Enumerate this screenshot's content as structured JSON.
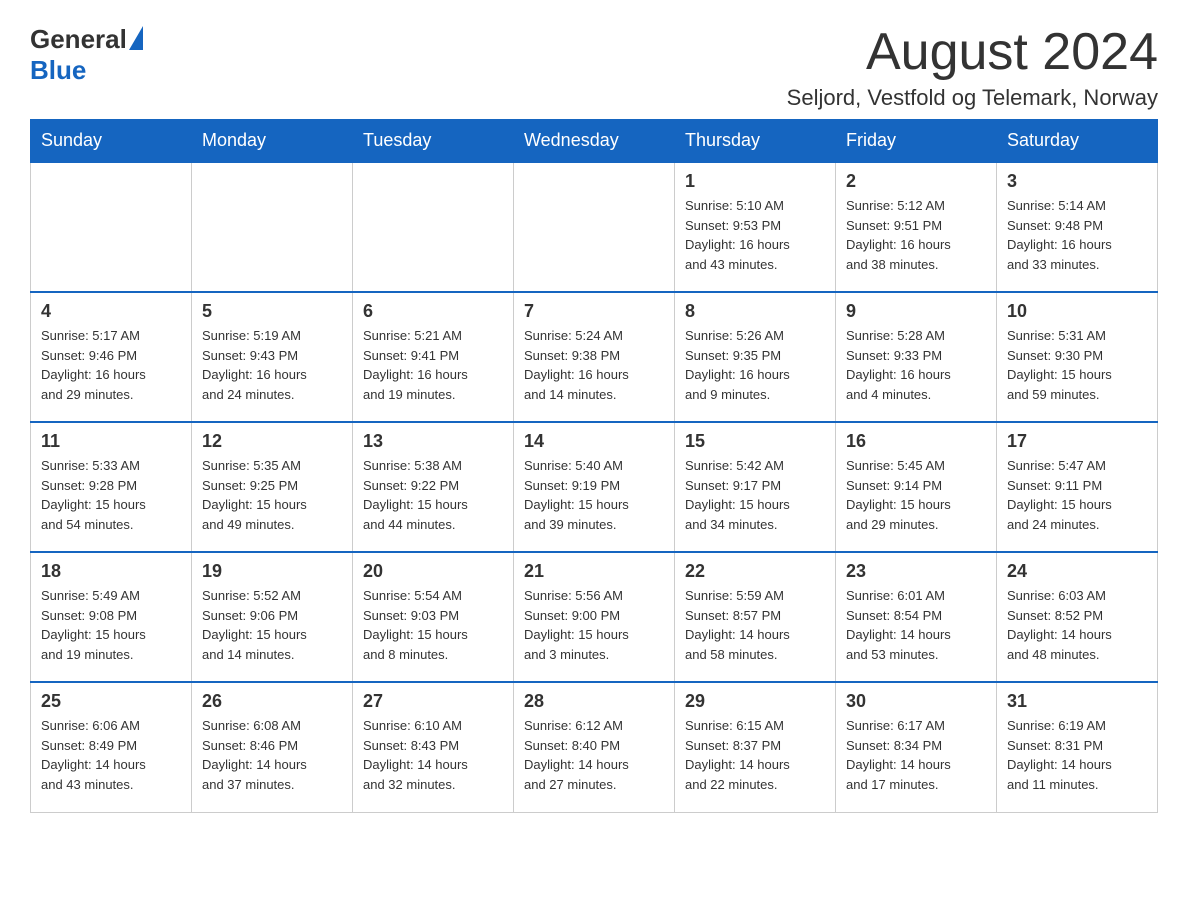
{
  "header": {
    "logo_general": "General",
    "logo_blue": "Blue",
    "month_title": "August 2024",
    "location": "Seljord, Vestfold og Telemark, Norway"
  },
  "weekdays": [
    "Sunday",
    "Monday",
    "Tuesday",
    "Wednesday",
    "Thursday",
    "Friday",
    "Saturday"
  ],
  "weeks": [
    [
      {
        "day": "",
        "info": ""
      },
      {
        "day": "",
        "info": ""
      },
      {
        "day": "",
        "info": ""
      },
      {
        "day": "",
        "info": ""
      },
      {
        "day": "1",
        "info": "Sunrise: 5:10 AM\nSunset: 9:53 PM\nDaylight: 16 hours\nand 43 minutes."
      },
      {
        "day": "2",
        "info": "Sunrise: 5:12 AM\nSunset: 9:51 PM\nDaylight: 16 hours\nand 38 minutes."
      },
      {
        "day": "3",
        "info": "Sunrise: 5:14 AM\nSunset: 9:48 PM\nDaylight: 16 hours\nand 33 minutes."
      }
    ],
    [
      {
        "day": "4",
        "info": "Sunrise: 5:17 AM\nSunset: 9:46 PM\nDaylight: 16 hours\nand 29 minutes."
      },
      {
        "day": "5",
        "info": "Sunrise: 5:19 AM\nSunset: 9:43 PM\nDaylight: 16 hours\nand 24 minutes."
      },
      {
        "day": "6",
        "info": "Sunrise: 5:21 AM\nSunset: 9:41 PM\nDaylight: 16 hours\nand 19 minutes."
      },
      {
        "day": "7",
        "info": "Sunrise: 5:24 AM\nSunset: 9:38 PM\nDaylight: 16 hours\nand 14 minutes."
      },
      {
        "day": "8",
        "info": "Sunrise: 5:26 AM\nSunset: 9:35 PM\nDaylight: 16 hours\nand 9 minutes."
      },
      {
        "day": "9",
        "info": "Sunrise: 5:28 AM\nSunset: 9:33 PM\nDaylight: 16 hours\nand 4 minutes."
      },
      {
        "day": "10",
        "info": "Sunrise: 5:31 AM\nSunset: 9:30 PM\nDaylight: 15 hours\nand 59 minutes."
      }
    ],
    [
      {
        "day": "11",
        "info": "Sunrise: 5:33 AM\nSunset: 9:28 PM\nDaylight: 15 hours\nand 54 minutes."
      },
      {
        "day": "12",
        "info": "Sunrise: 5:35 AM\nSunset: 9:25 PM\nDaylight: 15 hours\nand 49 minutes."
      },
      {
        "day": "13",
        "info": "Sunrise: 5:38 AM\nSunset: 9:22 PM\nDaylight: 15 hours\nand 44 minutes."
      },
      {
        "day": "14",
        "info": "Sunrise: 5:40 AM\nSunset: 9:19 PM\nDaylight: 15 hours\nand 39 minutes."
      },
      {
        "day": "15",
        "info": "Sunrise: 5:42 AM\nSunset: 9:17 PM\nDaylight: 15 hours\nand 34 minutes."
      },
      {
        "day": "16",
        "info": "Sunrise: 5:45 AM\nSunset: 9:14 PM\nDaylight: 15 hours\nand 29 minutes."
      },
      {
        "day": "17",
        "info": "Sunrise: 5:47 AM\nSunset: 9:11 PM\nDaylight: 15 hours\nand 24 minutes."
      }
    ],
    [
      {
        "day": "18",
        "info": "Sunrise: 5:49 AM\nSunset: 9:08 PM\nDaylight: 15 hours\nand 19 minutes."
      },
      {
        "day": "19",
        "info": "Sunrise: 5:52 AM\nSunset: 9:06 PM\nDaylight: 15 hours\nand 14 minutes."
      },
      {
        "day": "20",
        "info": "Sunrise: 5:54 AM\nSunset: 9:03 PM\nDaylight: 15 hours\nand 8 minutes."
      },
      {
        "day": "21",
        "info": "Sunrise: 5:56 AM\nSunset: 9:00 PM\nDaylight: 15 hours\nand 3 minutes."
      },
      {
        "day": "22",
        "info": "Sunrise: 5:59 AM\nSunset: 8:57 PM\nDaylight: 14 hours\nand 58 minutes."
      },
      {
        "day": "23",
        "info": "Sunrise: 6:01 AM\nSunset: 8:54 PM\nDaylight: 14 hours\nand 53 minutes."
      },
      {
        "day": "24",
        "info": "Sunrise: 6:03 AM\nSunset: 8:52 PM\nDaylight: 14 hours\nand 48 minutes."
      }
    ],
    [
      {
        "day": "25",
        "info": "Sunrise: 6:06 AM\nSunset: 8:49 PM\nDaylight: 14 hours\nand 43 minutes."
      },
      {
        "day": "26",
        "info": "Sunrise: 6:08 AM\nSunset: 8:46 PM\nDaylight: 14 hours\nand 37 minutes."
      },
      {
        "day": "27",
        "info": "Sunrise: 6:10 AM\nSunset: 8:43 PM\nDaylight: 14 hours\nand 32 minutes."
      },
      {
        "day": "28",
        "info": "Sunrise: 6:12 AM\nSunset: 8:40 PM\nDaylight: 14 hours\nand 27 minutes."
      },
      {
        "day": "29",
        "info": "Sunrise: 6:15 AM\nSunset: 8:37 PM\nDaylight: 14 hours\nand 22 minutes."
      },
      {
        "day": "30",
        "info": "Sunrise: 6:17 AM\nSunset: 8:34 PM\nDaylight: 14 hours\nand 17 minutes."
      },
      {
        "day": "31",
        "info": "Sunrise: 6:19 AM\nSunset: 8:31 PM\nDaylight: 14 hours\nand 11 minutes."
      }
    ]
  ]
}
